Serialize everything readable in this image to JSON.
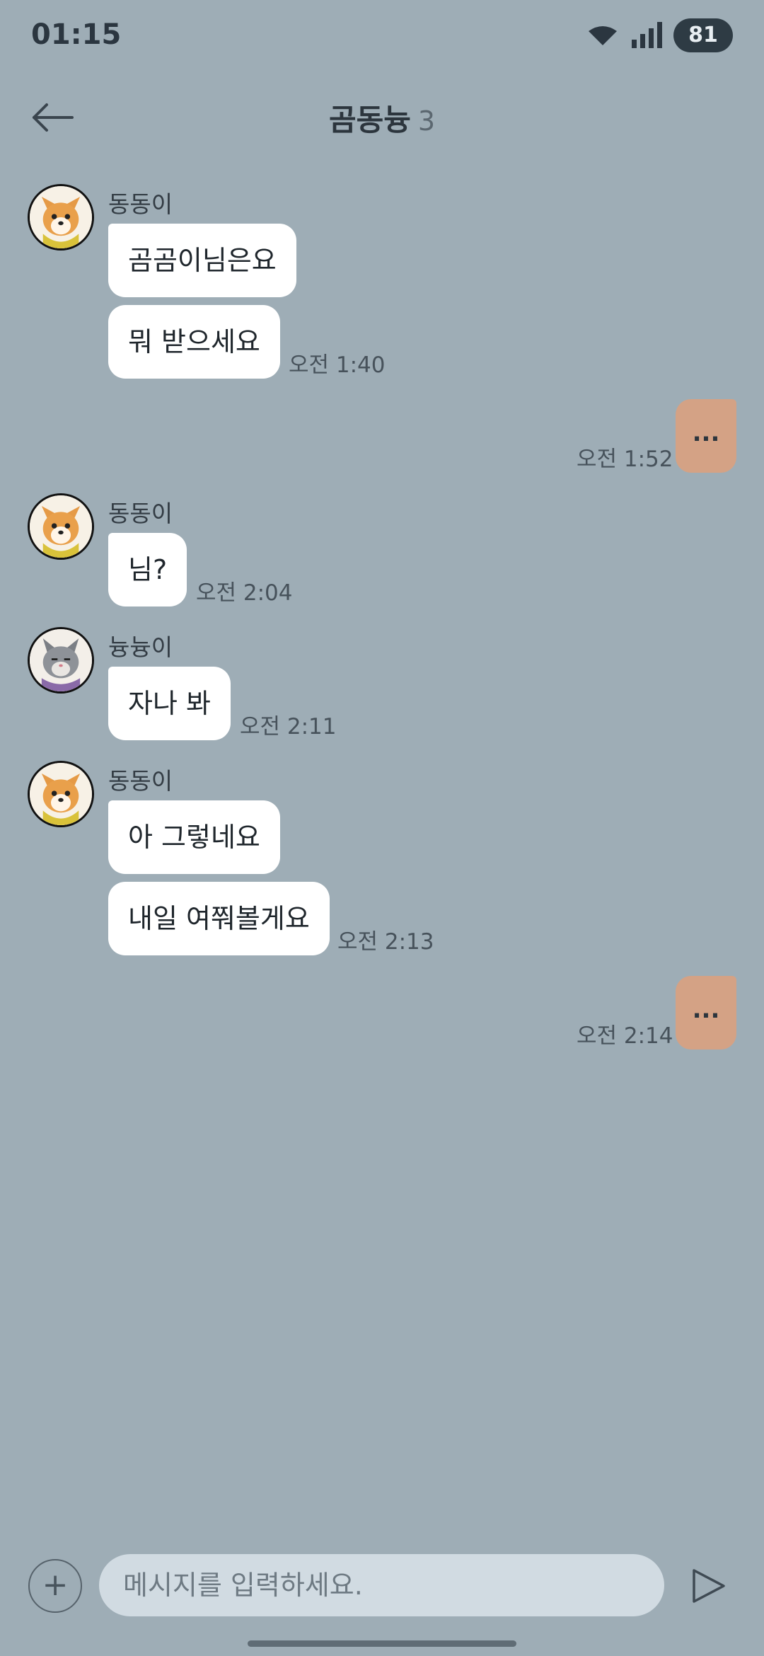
{
  "status_bar": {
    "time": "01:15",
    "battery": "81",
    "icons": [
      "wifi-icon",
      "signal-icon"
    ]
  },
  "header": {
    "back_icon": "arrow-left-icon",
    "title": "곰동늉",
    "member_count": "3"
  },
  "messages": [
    {
      "sender": "동동이",
      "avatar": "corgi-avatar",
      "bubbles": [
        "곰곰이님은요",
        "뭐 받으세요"
      ],
      "time": "오전 1:40"
    },
    {
      "mine": true,
      "text": "...",
      "time": "오전 1:52"
    },
    {
      "sender": "동동이",
      "avatar": "corgi-avatar",
      "bubbles": [
        "님?"
      ],
      "time": "오전 2:04"
    },
    {
      "sender": "늉늉이",
      "avatar": "cat-avatar",
      "bubbles": [
        "자나 봐"
      ],
      "time": "오전 2:11"
    },
    {
      "sender": "동동이",
      "avatar": "corgi-avatar",
      "bubbles": [
        "아 그렇네요",
        "내일 여쭤볼게요"
      ],
      "time": "오전 2:13"
    },
    {
      "mine": true,
      "text": "...",
      "time": "오전 2:14"
    }
  ],
  "input": {
    "placeholder": "메시지를 입력하세요.",
    "value": "",
    "add_label": "+",
    "send_icon": "send-icon"
  },
  "colors": {
    "background": "#9eadb6",
    "my_bubble": "#d4a285",
    "other_bubble": "#ffffff",
    "input_bg": "#d1dbe2"
  }
}
